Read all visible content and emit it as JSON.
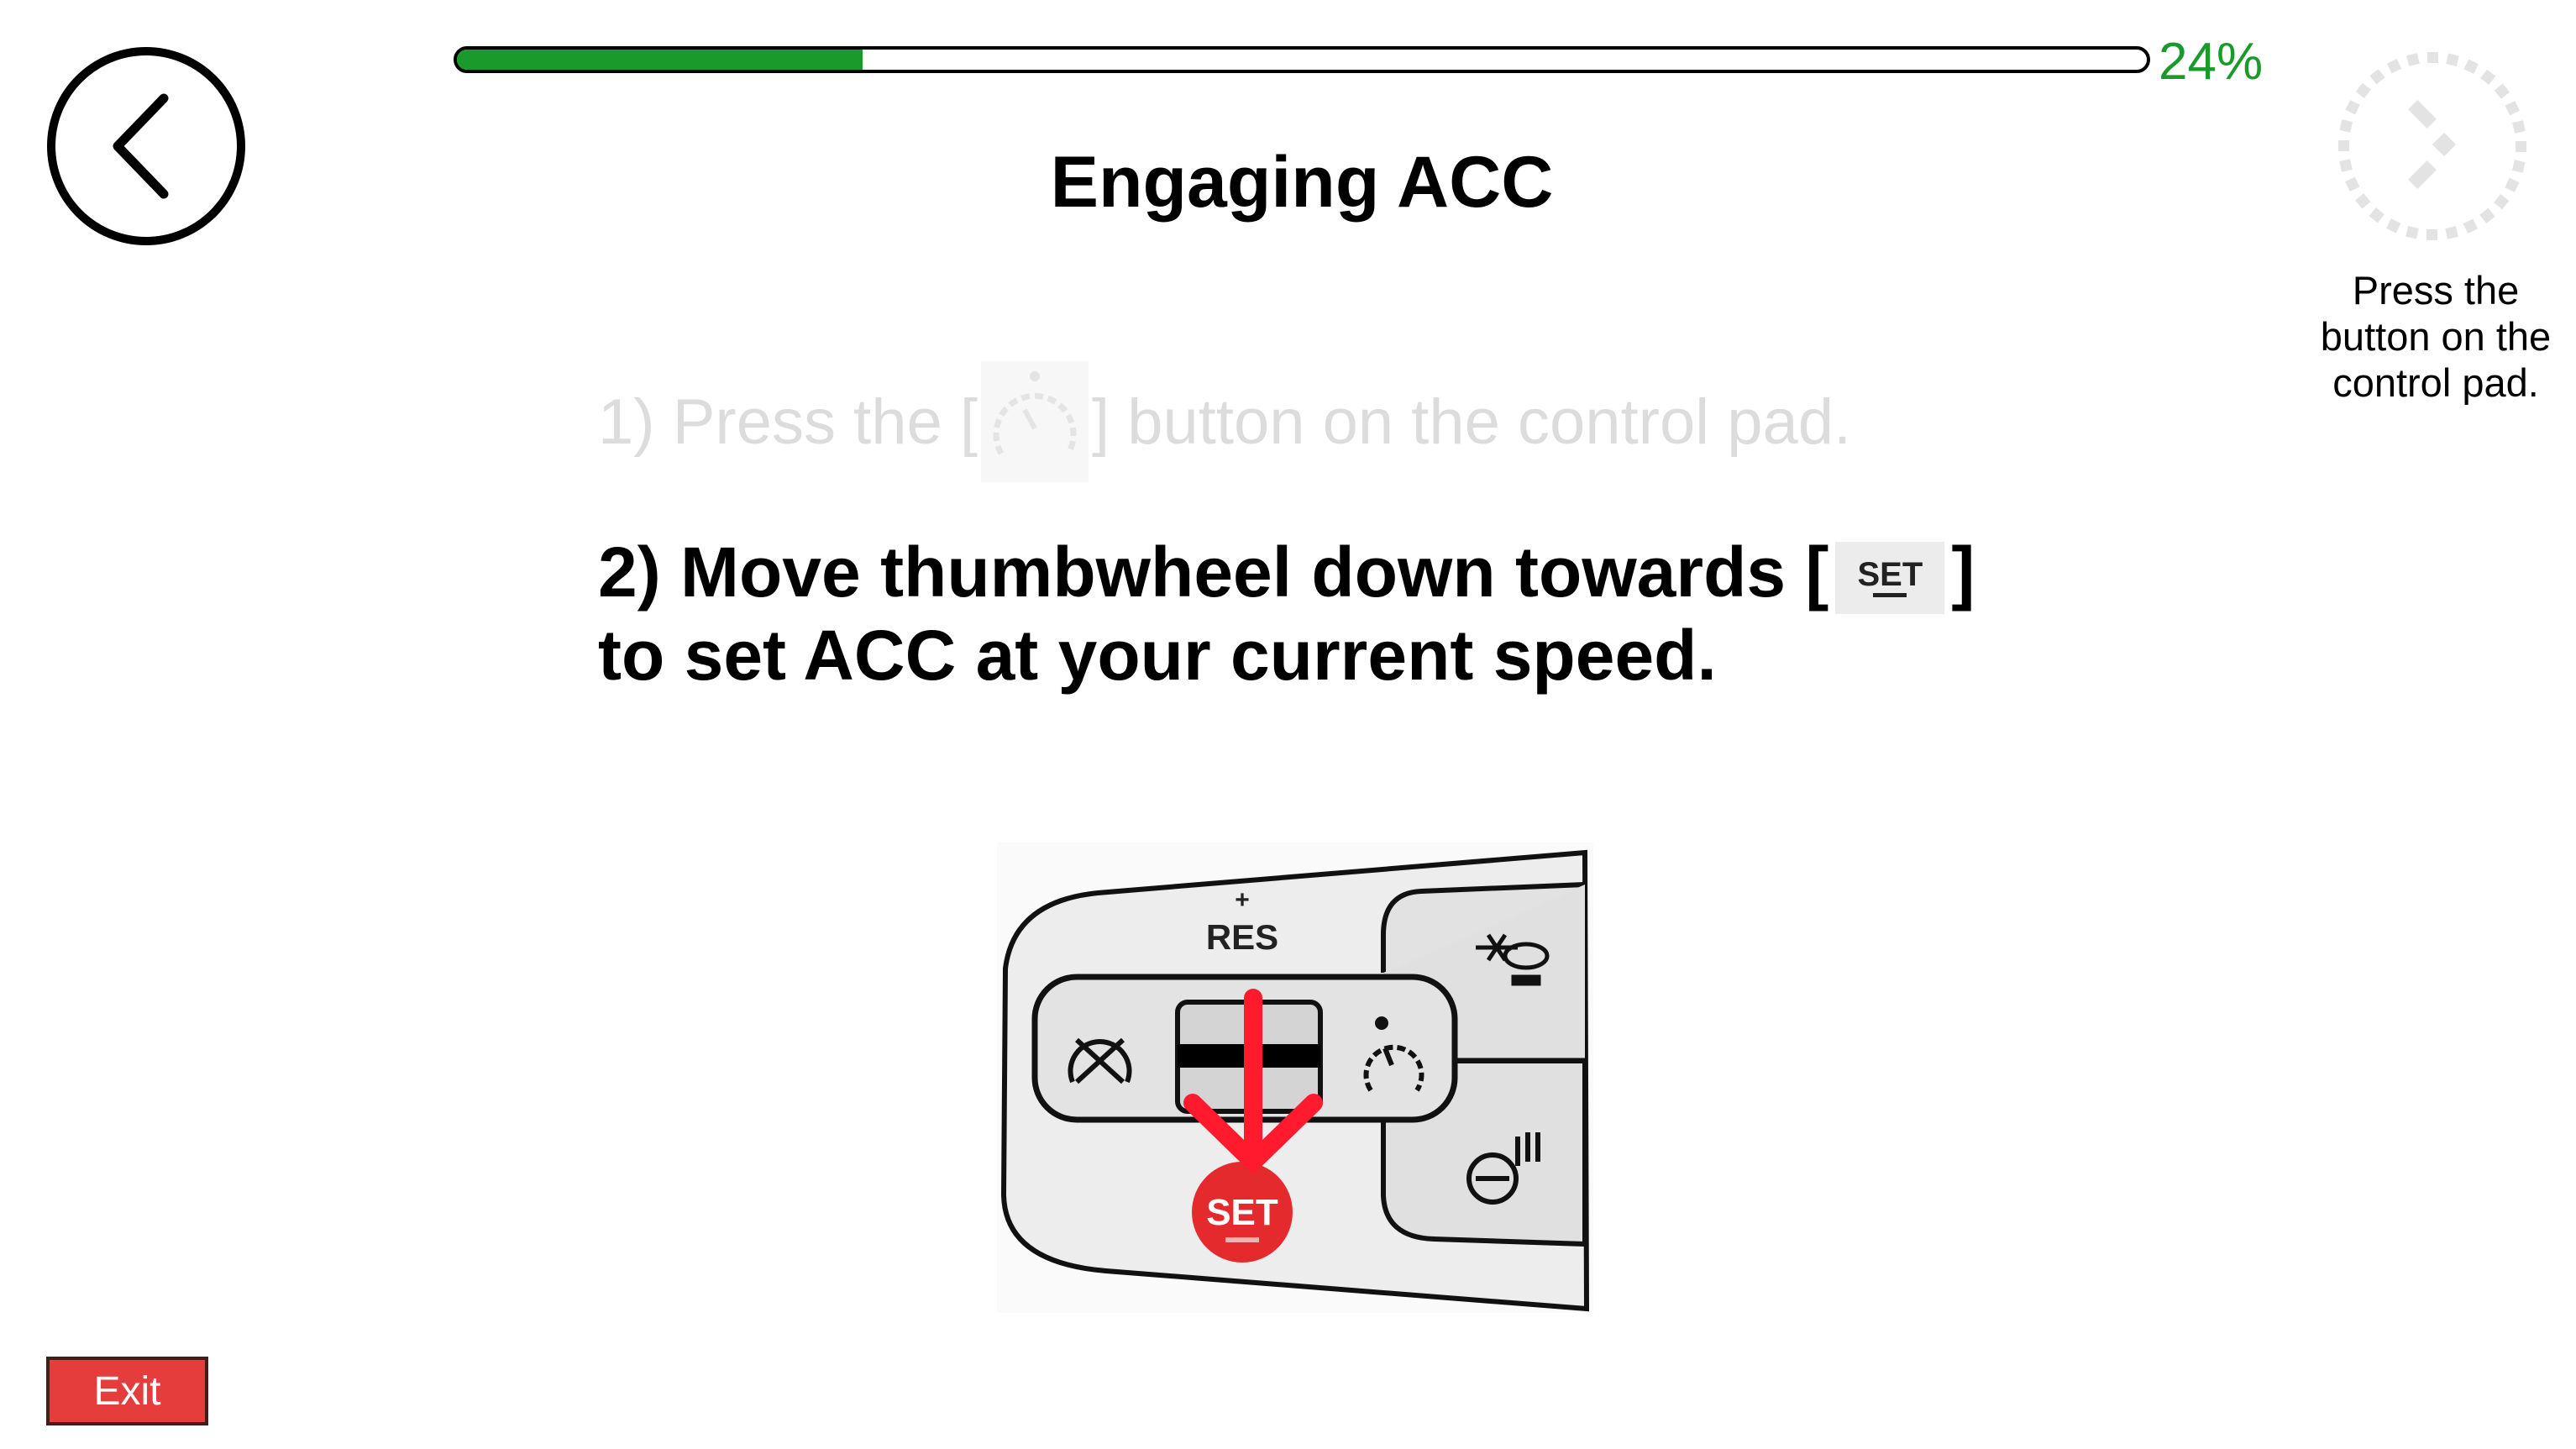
{
  "header": {
    "title": "Engaging ACC",
    "progress_percent": 24,
    "progress_label": "24%"
  },
  "steps": {
    "step1_prefix": "1) Press the [",
    "step1_suffix": "] button on the control pad.",
    "step2_line1_prefix": "2) Move thumbwheel down towards [",
    "step2_icon_label": "SET",
    "step2_line1_suffix": "]",
    "step2_line2": "to set ACC at your current speed."
  },
  "illustration": {
    "res_label": "RES",
    "set_label": "SET"
  },
  "hint": {
    "text_line1": "Press the",
    "text_line2": "button on the",
    "text_line3": "control pad."
  },
  "footer": {
    "exit_label": "Exit"
  },
  "colors": {
    "accent_green": "#1a9a2a",
    "exit_red": "#e53c3c",
    "arrow_red": "#ff1a2e"
  }
}
